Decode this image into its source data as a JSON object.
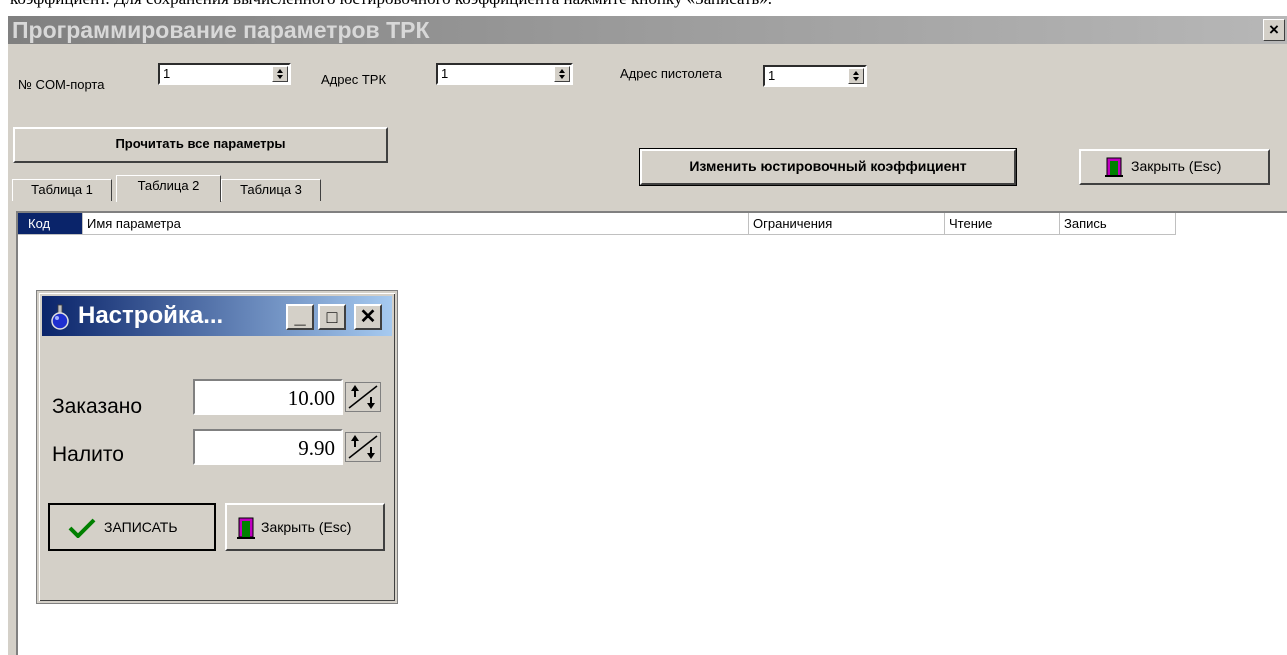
{
  "document_text": "коэффициент. Для сохранения вычисленного юстировочного коэффициента нажмите кнопку «Записать».",
  "window": {
    "title": "Программирование параметров ТРК",
    "close_label": "×"
  },
  "params": {
    "com_label": "№ COM-порта",
    "com_value": "1",
    "addr_label": "Адрес ТРК",
    "addr_value": "1",
    "pistol_label": "Адрес пистолета",
    "pistol_value": "1"
  },
  "buttons": {
    "read_all": "Прочитать все параметры",
    "change_coef": "Изменить юстировочный коэффициент",
    "close": "Закрыть (Esc)"
  },
  "tabs": [
    "Таблица 1",
    "Таблица 2",
    "Таблица 3"
  ],
  "active_tab": 1,
  "grid": {
    "columns": [
      "Код",
      "Имя параметра",
      "Ограничения",
      "Чтение",
      "Запись"
    ]
  },
  "dialog": {
    "title": "Настройка...",
    "ordered_label": "Заказано",
    "ordered_value": "10.00",
    "poured_label": "Налито",
    "poured_value": "9.90",
    "save_label": "ЗАПИСАТЬ",
    "close_label": "Закрыть (Esc)",
    "min_glyph": "_",
    "max_glyph": "□",
    "close_glyph": "✕"
  }
}
